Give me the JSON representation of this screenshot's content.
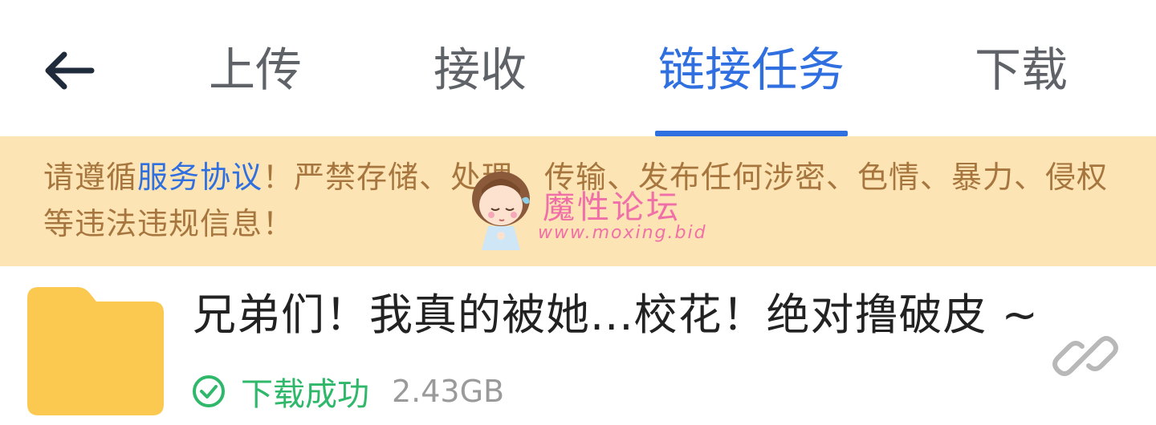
{
  "header": {
    "tabs": [
      {
        "label": "上传",
        "active": false
      },
      {
        "label": "接收",
        "active": false
      },
      {
        "label": "链接任务",
        "active": true
      },
      {
        "label": "下载",
        "active": false
      }
    ],
    "back_icon": "arrow-left-icon"
  },
  "notice": {
    "prefix": "请遵循",
    "link": "服务协议",
    "suffix": "！严禁存储、处理、传输、发布任何涉密、色情、暴力、侵权等违法违规信息！"
  },
  "watermark": {
    "title": "魔性论坛",
    "url": "www.moxing.bid"
  },
  "file": {
    "name": "兄弟们！我真的被她...校花！绝对撸破皮 ~",
    "status": "下载成功",
    "size": "2.43GB",
    "icon": "folder-icon",
    "action_icon": "link-icon"
  },
  "colors": {
    "accent": "#2f6fe0",
    "notice_bg": "#fce4b4",
    "notice_text": "#a7763e",
    "success": "#2fb86a",
    "folder": "#fbc94f"
  }
}
